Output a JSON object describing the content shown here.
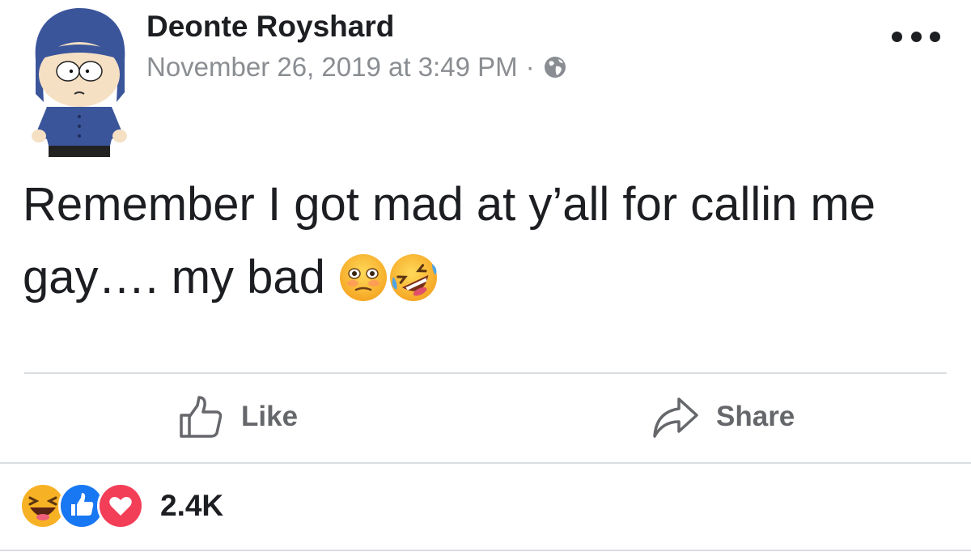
{
  "post": {
    "author": "Deonte Royshard",
    "date": "November 26, 2019 at 3:49 PM",
    "separator": "·",
    "privacy_icon": "globe-icon",
    "text": "Remember I got mad at y’all for callin me gay…. my bad",
    "emojis": [
      "flushed-face-emoji",
      "rolling-on-floor-laughing-emoji"
    ]
  },
  "actions": {
    "like_label": "Like",
    "share_label": "Share"
  },
  "reactions": {
    "icons": [
      "haha-reaction-icon",
      "like-reaction-icon",
      "love-reaction-icon"
    ],
    "count": "2.4K"
  },
  "colors": {
    "like_blue": "#1877f2",
    "love_red": "#f33e58",
    "haha_yellow": "#f7b125",
    "meta_gray": "#8a8d91"
  }
}
